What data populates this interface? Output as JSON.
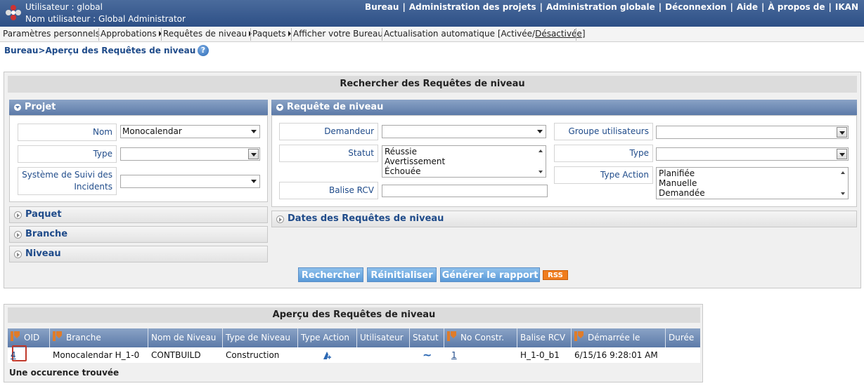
{
  "header": {
    "user_line": "Utilisateur : global",
    "name_line": "Nom utilisateur : Global Administrator",
    "nav": [
      "Bureau",
      "Administration des projets",
      "Administration globale",
      "Déconnexion",
      "Aide",
      "À propos de",
      "IKAN"
    ]
  },
  "menu": {
    "items": [
      "Paramètres personnels",
      "Approbations",
      "Requêtes de niveau",
      "Paquets",
      "Afficher votre Bureau"
    ],
    "auto_refresh_prefix": "Actualisation automatique [Activée/",
    "auto_refresh_off": "Désactivée",
    "auto_refresh_suffix": "]"
  },
  "breadcrumb": "Bureau>Aperçu des Requêtes de niveau",
  "help_label": "?",
  "search": {
    "title": "Rechercher des Requêtes de niveau",
    "projet": {
      "header": "Projet",
      "nom_label": "Nom",
      "nom_value": "Monocalendar",
      "type_label": "Type",
      "type_value": "",
      "suivi_label_1": "Système de Suivi des",
      "suivi_label_2": "Incidents",
      "suivi_value": ""
    },
    "collapsed": [
      "Paquet",
      "Branche",
      "Niveau"
    ],
    "requete": {
      "header": "Requête de niveau",
      "demandeur_label": "Demandeur",
      "statut_label": "Statut",
      "statut_options": [
        "Réussie",
        "Avertissement",
        "Échouée"
      ],
      "balise_label": "Balise RCV",
      "groupe_label": "Groupe utilisateurs",
      "type_label": "Type",
      "type_action_label": "Type Action",
      "type_action_options": [
        "Planifiée",
        "Manuelle",
        "Demandée"
      ]
    },
    "dates_header": "Dates des Requêtes de niveau",
    "buttons": {
      "search": "Rechercher",
      "reset": "Réinitialiser",
      "report": "Générer le rapport",
      "rss": "RSS"
    }
  },
  "results": {
    "title": "Aperçu des Requêtes de niveau",
    "columns": [
      "OID",
      "Branche",
      "Nom de Niveau",
      "Type de Niveau",
      "Type Action",
      "Utilisateur",
      "Statut",
      "No Constr.",
      "Balise RCV",
      "Démarrée le",
      "Durée"
    ],
    "rows": [
      {
        "oid": "4",
        "branche": "Monocalendar H_1-0",
        "nom_niveau": "CONTBUILD",
        "type_niveau": "Construction",
        "type_action_icon": "scheduled-action-icon",
        "utilisateur": "",
        "statut": "~",
        "no_constr": "1",
        "balise": "H_1-0_b1",
        "demarree": "6/15/16 9:28:01 AM",
        "duree": ""
      }
    ],
    "found_text": "Une occurence trouvée"
  },
  "colors": {
    "header_bg": "#2d4f86",
    "section_header": "#5c7aa8",
    "button": "#5a9ad8",
    "rss": "#f07d1e",
    "link": "#1f4b8a",
    "highlight_box": "#c0392b"
  }
}
